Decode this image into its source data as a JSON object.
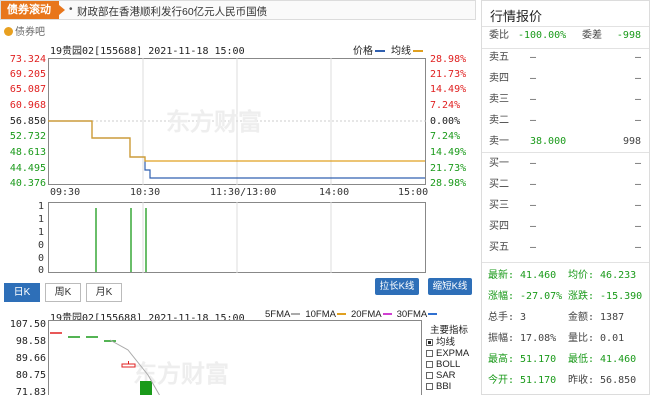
{
  "news": {
    "tag": "债券滚动",
    "bullet": "•",
    "headline": "财政部在香港顺利发行60亿元人民币国债"
  },
  "bond_bar": {
    "label": "债券吧"
  },
  "timeshare": {
    "title": "19贵园02[155688] 2021-11-18 15:00",
    "legend_price": "价格",
    "legend_avg": "均线",
    "left_labels": [
      "73.324",
      "69.205",
      "65.087",
      "60.968",
      "56.850",
      "52.732",
      "48.613",
      "44.495",
      "40.376"
    ],
    "right_labels": [
      "28.98%",
      "21.73%",
      "14.49%",
      "7.24%",
      "0.00%",
      "7.24%",
      "14.49%",
      "21.73%",
      "28.98%"
    ],
    "x_labels": [
      "09:30",
      "10:30",
      "11:30/13:00",
      "14:00",
      "15:00"
    ],
    "vol_labels": [
      "1",
      "1",
      "1",
      "0",
      "0",
      "0"
    ]
  },
  "kline": {
    "tabs": [
      "日K",
      "周K",
      "月K"
    ],
    "btn_long": "拉长K线",
    "btn_short": "缩短K线",
    "title": "19贵园02[155688] 2021-11-18 15:00",
    "legend": [
      "5FMA",
      "10FMA",
      "20FMA",
      "30FMA"
    ],
    "y_labels": [
      "107.50",
      "98.58",
      "89.66",
      "80.75",
      "71.83"
    ],
    "indicators_title": "主要指标",
    "indicators": [
      "均线",
      "EXPMA",
      "BOLL",
      "SAR",
      "BBI"
    ]
  },
  "quote": {
    "title": "行情报价",
    "webi": {
      "label": "委比",
      "value": "-100.00%"
    },
    "weicha": {
      "label": "委差",
      "value": "-998"
    },
    "sells": [
      {
        "label": "卖五",
        "price": "–",
        "vol": "–"
      },
      {
        "label": "卖四",
        "price": "–",
        "vol": "–"
      },
      {
        "label": "卖三",
        "price": "–",
        "vol": "–"
      },
      {
        "label": "卖二",
        "price": "–",
        "vol": "–"
      },
      {
        "label": "卖一",
        "price": "38.000",
        "vol": "998"
      }
    ],
    "buys": [
      {
        "label": "买一",
        "price": "–",
        "vol": "–"
      },
      {
        "label": "买二",
        "price": "–",
        "vol": "–"
      },
      {
        "label": "买三",
        "price": "–",
        "vol": "–"
      },
      {
        "label": "买四",
        "price": "–",
        "vol": "–"
      },
      {
        "label": "买五",
        "price": "–",
        "vol": "–"
      }
    ],
    "stats": [
      {
        "a": "最新: 41.460",
        "b": "均价: 46.233"
      },
      {
        "a": "涨幅: -27.07%",
        "b": "涨跌: -15.390"
      },
      {
        "a": "总手: 3",
        "b": "金额: 1387"
      },
      {
        "a": "振幅: 17.08%",
        "b": "量比: 0.01"
      },
      {
        "a": "最高: 51.170",
        "b": "最低: 41.460"
      },
      {
        "a": "今开: 51.170",
        "b": "昨收: 56.850"
      }
    ]
  },
  "colors": {
    "accent": "#e8761c",
    "tab_active": "#2e6fb8",
    "price_line": "#3060b0",
    "avg_line": "#e0a020",
    "up": "#e02020",
    "down": "#1a9a1a"
  }
}
